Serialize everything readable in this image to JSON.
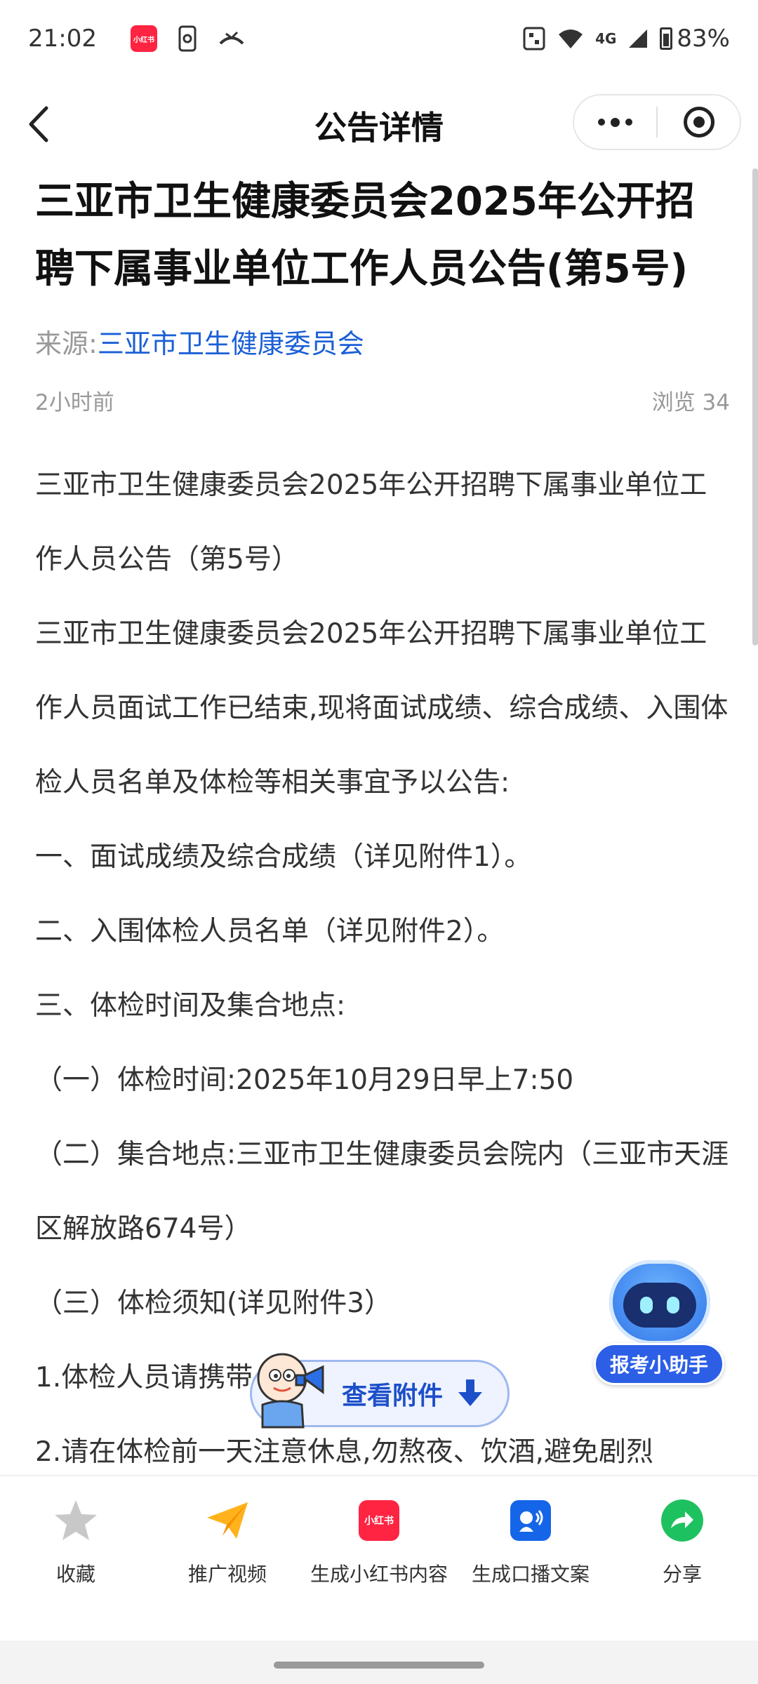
{
  "status_bar": {
    "time": "21:02",
    "network": "4G",
    "battery": "83%"
  },
  "nav": {
    "title": "公告详情"
  },
  "article": {
    "title": "三亚市卫生健康委员会2025年公开招聘下属事业单位工作人员公告(第5号)",
    "source_label": "来源:",
    "source_name": "三亚市卫生健康委员会",
    "time_ago": "2小时前",
    "views": "浏览 34",
    "paragraphs": [
      "三亚市卫生健康委员会2025年公开招聘下属事业单位工作人员公告（第5号）",
      "三亚市卫生健康委员会2025年公开招聘下属事业单位工作人员面试工作已结束,现将面试成绩、综合成绩、入围体检人员名单及体检等相关事宜予以公告:",
      "一、面试成绩及综合成绩（详见附件1）。",
      "二、入围体检人员名单（详见附件2）。",
      "三、体检时间及集合地点:",
      "（一）体检时间:2025年10月29日早上7:50",
      "（二）集合地点:三亚市卫生健康委员会院内（三亚市天涯区解放路674号）",
      "（三）体检须知(详见附件3）",
      "1.体检人员请携带",
      "2.请在体检前一天注意休息,勿熬夜、饮酒,避免剧烈"
    ]
  },
  "helper": {
    "label": "报考小助手"
  },
  "attachment_button": {
    "label": "查看附件"
  },
  "bottom_actions": [
    {
      "label": "收藏",
      "icon": "star-icon"
    },
    {
      "label": "推广视频",
      "icon": "paper-plane-icon"
    },
    {
      "label": "生成小红书内容",
      "icon": "xiaohongshu-icon",
      "badge": "小红书"
    },
    {
      "label": "生成口播文案",
      "icon": "voice-icon"
    },
    {
      "label": "分享",
      "icon": "share-icon"
    }
  ],
  "app_badge_text": "小红书"
}
